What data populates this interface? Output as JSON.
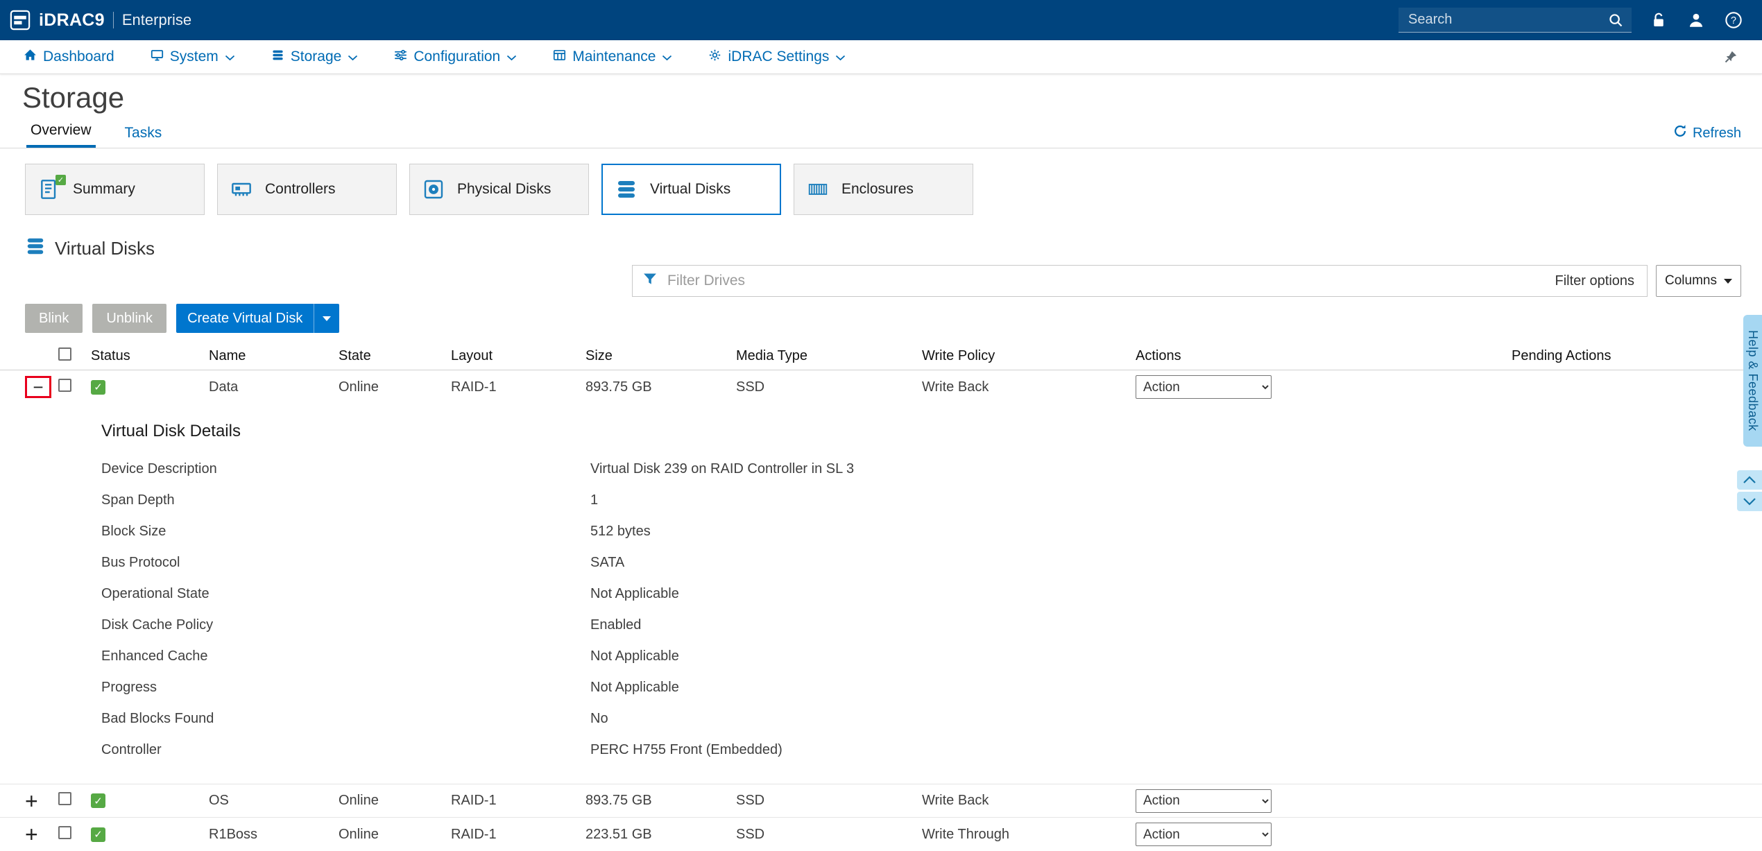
{
  "theme": {
    "topbar": "#00447e",
    "accent": "#006bb4",
    "accent-bright": "#0076ce",
    "icon-blue": "#1d7fbd",
    "green": "#56a944",
    "danger": "#e8001d",
    "help-tab": "#a6d7f2"
  },
  "header": {
    "product": "iDRAC9",
    "edition": "Enterprise",
    "search_placeholder": "Search"
  },
  "nav": {
    "items": [
      {
        "label": "Dashboard"
      },
      {
        "label": "System"
      },
      {
        "label": "Storage"
      },
      {
        "label": "Configuration"
      },
      {
        "label": "Maintenance"
      },
      {
        "label": "iDRAC Settings"
      }
    ]
  },
  "page": {
    "title": "Storage",
    "tabs": [
      {
        "label": "Overview"
      },
      {
        "label": "Tasks"
      }
    ],
    "refresh_label": "Refresh"
  },
  "cards": [
    {
      "label": "Summary"
    },
    {
      "label": "Controllers"
    },
    {
      "label": "Physical Disks"
    },
    {
      "label": "Virtual Disks"
    },
    {
      "label": "Enclosures"
    }
  ],
  "section": {
    "title": "Virtual Disks"
  },
  "filter": {
    "placeholder": "Filter Drives",
    "options_label": "Filter options",
    "columns_label": "Columns"
  },
  "toolbar": {
    "blink_label": "Blink",
    "unblink_label": "Unblink",
    "create_label": "Create Virtual Disk"
  },
  "table": {
    "headers": [
      "Status",
      "Name",
      "State",
      "Layout",
      "Size",
      "Media Type",
      "Write Policy",
      "Actions",
      "Pending Actions"
    ],
    "rows": [
      {
        "name": "Data",
        "state": "Online",
        "layout": "RAID-1",
        "size": "893.75 GB",
        "media_type": "SSD",
        "write_policy": "Write Back",
        "action": "Action"
      },
      {
        "name": "OS",
        "state": "Online",
        "layout": "RAID-1",
        "size": "893.75 GB",
        "media_type": "SSD",
        "write_policy": "Write Back",
        "action": "Action"
      },
      {
        "name": "R1Boss",
        "state": "Online",
        "layout": "RAID-1",
        "size": "223.51 GB",
        "media_type": "SSD",
        "write_policy": "Write Through",
        "action": "Action"
      }
    ]
  },
  "details": {
    "title": "Virtual Disk Details",
    "rows": [
      {
        "label": "Device Description",
        "value": "Virtual Disk 239 on RAID Controller in SL 3"
      },
      {
        "label": "Span Depth",
        "value": "1"
      },
      {
        "label": "Block Size",
        "value": "512 bytes"
      },
      {
        "label": "Bus Protocol",
        "value": "SATA"
      },
      {
        "label": "Operational State",
        "value": "Not Applicable"
      },
      {
        "label": "Disk Cache Policy",
        "value": "Enabled"
      },
      {
        "label": "Enhanced Cache",
        "value": "Not Applicable"
      },
      {
        "label": "Progress",
        "value": "Not Applicable"
      },
      {
        "label": "Bad Blocks Found",
        "value": "No"
      },
      {
        "label": "Controller",
        "value": "PERC H755 Front (Embedded)"
      }
    ]
  },
  "side": {
    "help_label": "Help & Feedback"
  }
}
